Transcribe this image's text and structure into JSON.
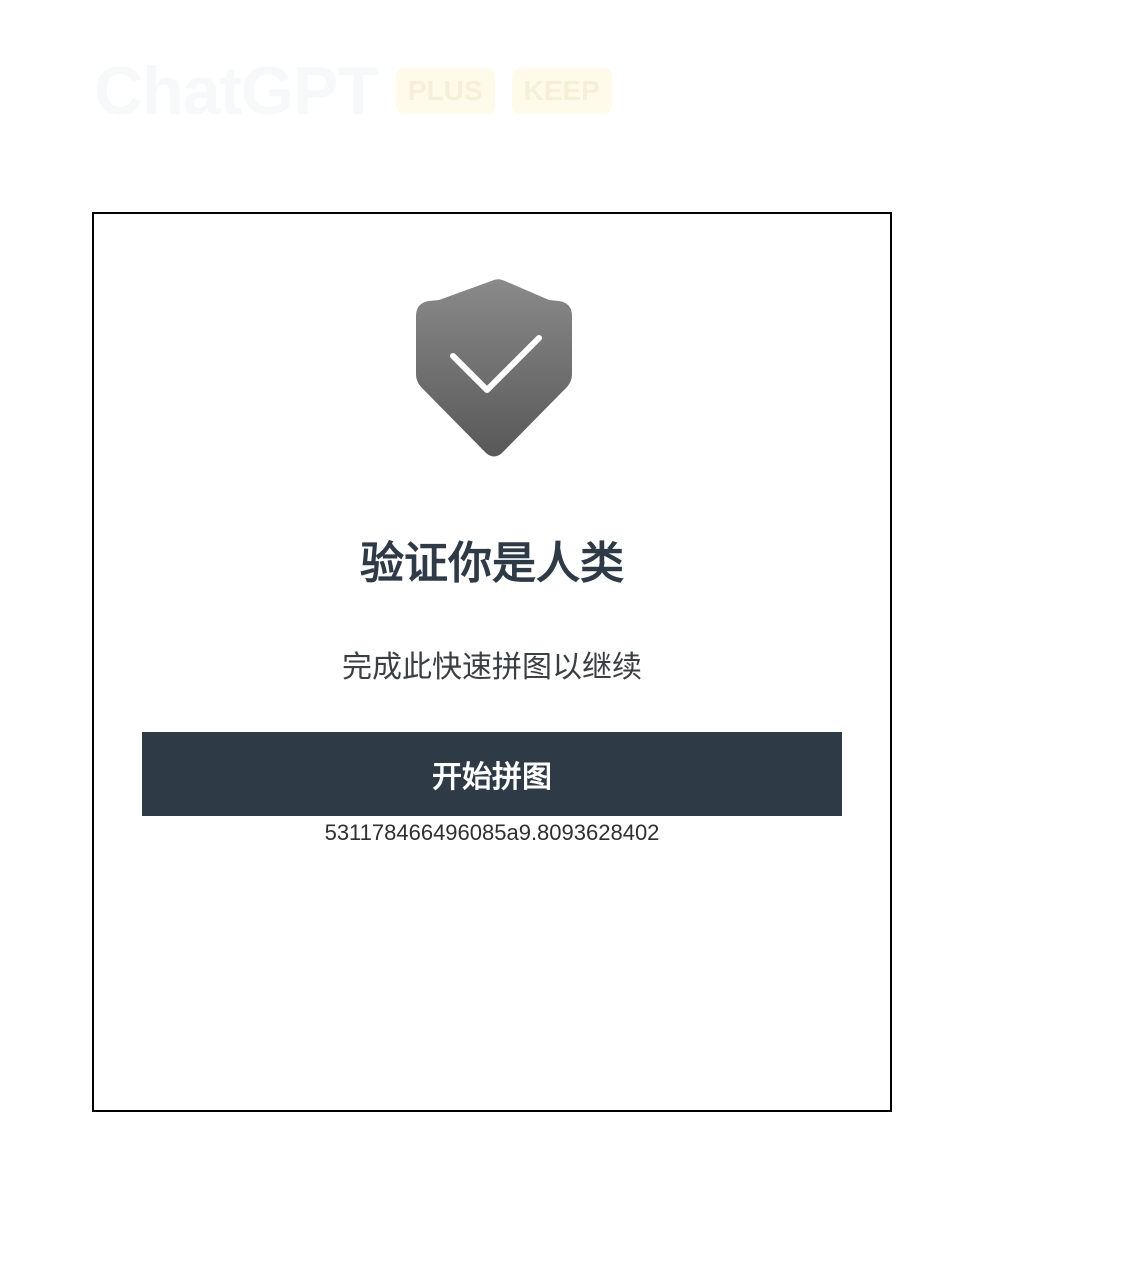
{
  "brand": {
    "title": "ChatGPT",
    "badges": [
      "PLUS",
      "KEEP"
    ]
  },
  "verification": {
    "icon": "shield-check-icon",
    "heading": "验证你是人类",
    "subtitle": "完成此快速拼图以继续",
    "start_button_label": "开始拼图",
    "session_code": "531178466496085a9.8093628402"
  },
  "colors": {
    "button_background": "#2e3a46",
    "heading_text": "#2f3a47",
    "shield_top": "#8a8a8a",
    "shield_bottom": "#585858"
  }
}
